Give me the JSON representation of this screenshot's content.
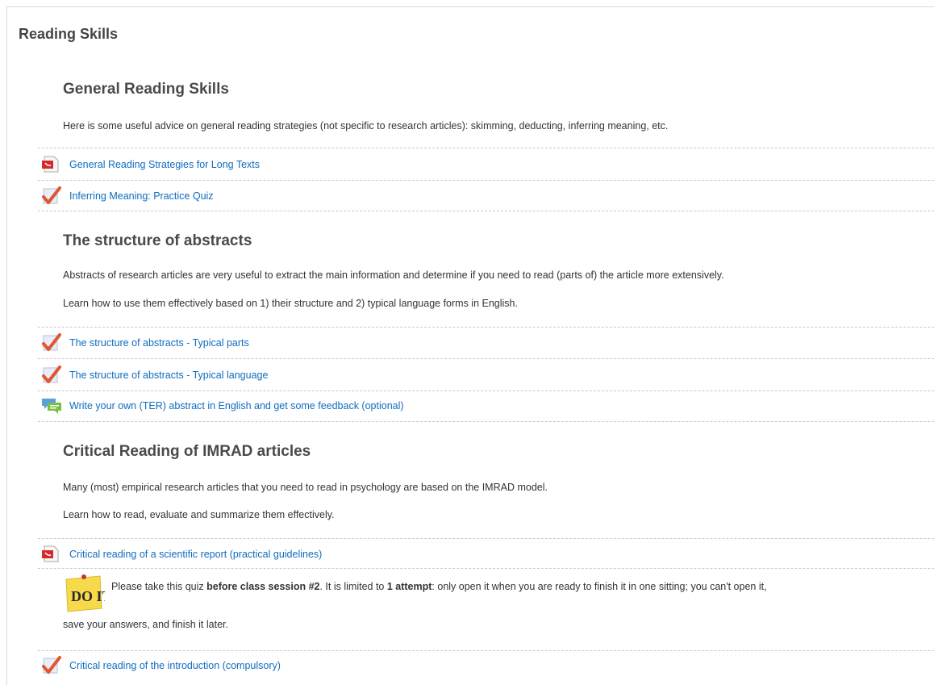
{
  "section": {
    "title": "Reading Skills"
  },
  "general": {
    "title": "General Reading Skills",
    "desc": "Here is some useful advice on general reading strategies (not specific to research articles): skimming, deducting, inferring meaning, etc.",
    "items": [
      {
        "icon": "pdf-icon",
        "label": "General Reading Strategies for Long Texts"
      },
      {
        "icon": "quiz-check-icon",
        "label": "Inferring Meaning: Practice Quiz"
      }
    ]
  },
  "abstracts": {
    "title": "The structure of abstracts",
    "desc1": "Abstracts of research articles are very useful to extract the main information and determine if you need to read (parts of) the article more extensively.",
    "desc2": "Learn how to use them effectively based on 1) their structure and 2) typical language forms in English.",
    "items": [
      {
        "icon": "quiz-check-icon",
        "label": "The structure of abstracts - Typical parts"
      },
      {
        "icon": "quiz-check-icon",
        "label": "The structure of abstracts - Typical language"
      },
      {
        "icon": "forum-icon",
        "label": "Write your own (TER) abstract in English and get some feedback (optional)"
      }
    ]
  },
  "imrad": {
    "title": "Critical Reading of IMRAD articles",
    "desc1": "Many (most) empirical research articles that you need to read in psychology are based on the IMRAD model.",
    "desc2": "Learn how to read, evaluate and summarize them effectively.",
    "items": [
      {
        "icon": "pdf-icon",
        "label": "Critical reading of a scientific report (practical guidelines)"
      },
      {
        "icon": "quiz-check-icon",
        "label": "Critical reading of the introduction (compulsory)"
      }
    ],
    "note": {
      "icon": "do-it-note-icon",
      "text_a": "Please take this quiz ",
      "bold_a": "before class session #2",
      "text_b": ". It is limited to ",
      "bold_b": "1 attempt",
      "text_c": ": only open it when you are ready to finish it in one sitting; you can't open it,",
      "line2": "save your answers, and finish it later."
    }
  }
}
